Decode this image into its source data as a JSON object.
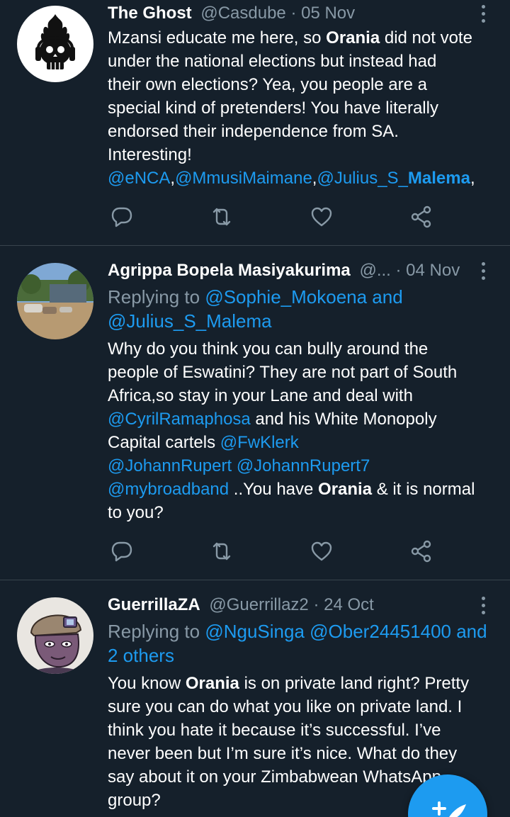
{
  "colors": {
    "background": "#15202b",
    "accent": "#1d9bf0",
    "muted": "#8899a6",
    "divider": "#38444d"
  },
  "tweets": [
    {
      "author": "The Ghost",
      "meta": "@Casdube · 05 Nov",
      "lines": [
        [
          "Mzansi educate me here, so ",
          "Orania",
          " did not vote"
        ],
        "under the national elections but instead had",
        "their own elections?  Yea, you people are a",
        "special kind of  pretenders! You have literally",
        "endorsed their independence from SA.",
        "Interesting!",
        [
          "@eNCA",
          ",",
          "@MmusiMaimane",
          ",",
          "@Julius_S_",
          "Malema",
          ","
        ]
      ]
    },
    {
      "author": "Agrippa Bopela Masiyakurima",
      "meta": "@... · 04 Nov",
      "replying": [
        "Replying to ",
        "@Sophie_Mokoena and",
        "@Julius_S_Malema"
      ],
      "lines": [
        "Why do you think you can bully around the",
        "people of Eswatini? They are not part of South",
        "Africa,so stay in your Lane and deal with",
        [
          "@CyrilRamaphosa",
          " and his White Monopoly"
        ],
        [
          "Capital cartels ",
          "@FwKlerk"
        ],
        [
          "@JohannRupert",
          " ",
          "@JohannRupert7"
        ],
        [
          "@mybroadband",
          " ..You have ",
          "Orania",
          " & it is normal"
        ],
        "to you?"
      ]
    },
    {
      "author": "GuerrillaZA",
      "meta": "@Guerrillaz2 · 24 Oct",
      "replying": [
        "Replying to ",
        "@NguSinga @Ober24451400 and",
        "2 others"
      ],
      "lines": [
        [
          "You know ",
          "Orania",
          " is on private land right? Pretty"
        ],
        "sure you can do what you like on private land. I",
        "think you hate it because it’s successful. I’ve",
        "never been but I’m sure it’s nice. What do they",
        "say about it on your Zimbabwean WhatsApp",
        "group?"
      ]
    }
  ],
  "icons": [
    "reply-icon",
    "retweet-icon",
    "like-icon",
    "share-icon",
    "more-options-icon",
    "compose-tweet-icon"
  ],
  "compose_button": {
    "icon": "compose-tweet-icon"
  }
}
